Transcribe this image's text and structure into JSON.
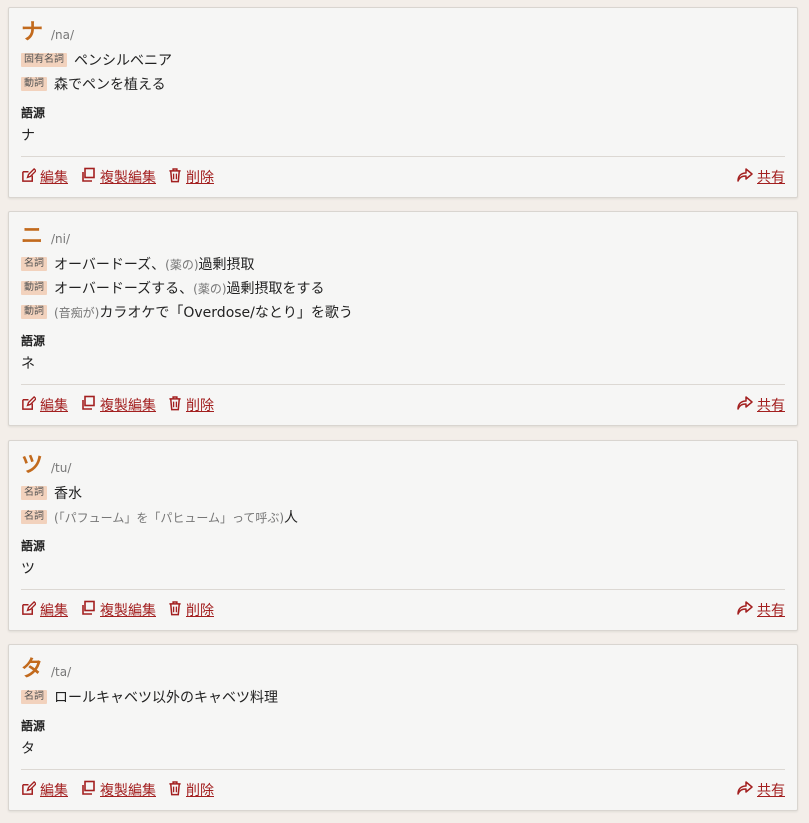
{
  "entries": [
    {
      "word": "ナ",
      "pron": "/na/",
      "senses": [
        {
          "pos": "固有名詞",
          "note": "",
          "text": "ペンシルベニア"
        },
        {
          "pos": "動詞",
          "note": "",
          "text": "森でペンを植える"
        }
      ],
      "etym_label": "語源",
      "etym": "ナ"
    },
    {
      "word": "ニ",
      "pron": "/ni/",
      "senses": [
        {
          "pos": "名詞",
          "pre": "オーバードーズ、",
          "note": "(薬の)",
          "text": "過剰摂取"
        },
        {
          "pos": "動詞",
          "pre": "オーバードーズする、",
          "note": "(薬の)",
          "text": "過剰摂取をする"
        },
        {
          "pos": "動詞",
          "pre": "",
          "note": "(音痴が)",
          "text": "カラオケで「Overdose/なとり」を歌う"
        }
      ],
      "etym_label": "語源",
      "etym": "ネ"
    },
    {
      "word": "ツ",
      "pron": "/tu/",
      "senses": [
        {
          "pos": "名詞",
          "note": "",
          "text": "香水"
        },
        {
          "pos": "名詞",
          "pre": "",
          "note": "(「パフューム」を「パヒューム」って呼ぶ)",
          "text": "人"
        }
      ],
      "etym_label": "語源",
      "etym": "ツ"
    },
    {
      "word": "タ",
      "pron": "/ta/",
      "senses": [
        {
          "pos": "名詞",
          "note": "",
          "text": "ロールキャベツ以外のキャベツ料理"
        }
      ],
      "etym_label": "語源",
      "etym": "タ"
    }
  ],
  "actions": {
    "edit": "編集",
    "copy_edit": "複製編集",
    "delete": "削除",
    "share": "共有"
  },
  "colors": {
    "accent": "#c26a1d",
    "link": "#a32020",
    "pos_bg": "#f2d2bd"
  }
}
